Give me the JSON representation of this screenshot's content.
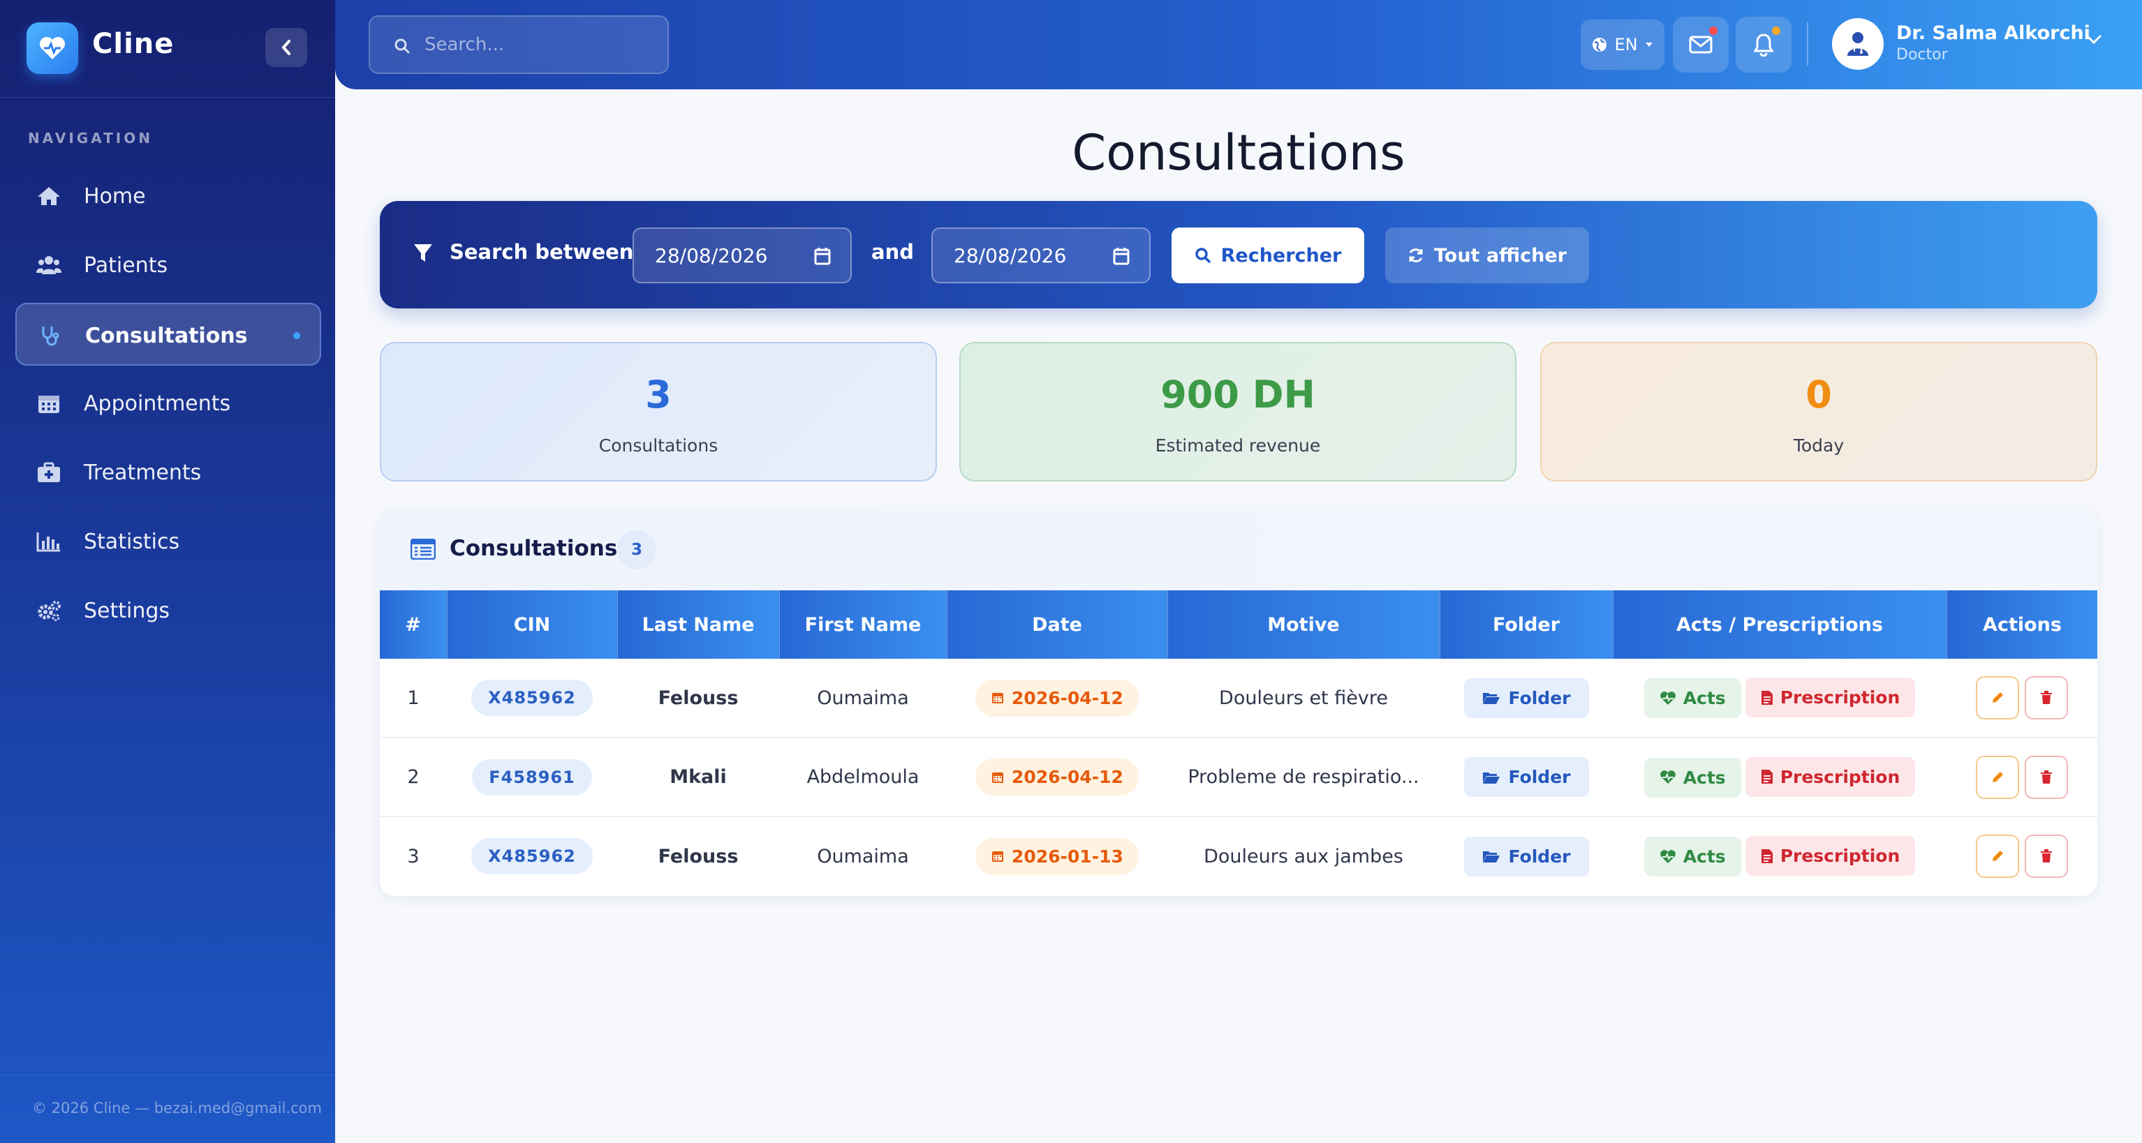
{
  "app": {
    "name": "Cline"
  },
  "sidebar": {
    "nav_title": "NAVIGATION",
    "items": [
      {
        "label": "Home",
        "icon": "home-icon",
        "active": false
      },
      {
        "label": "Patients",
        "icon": "users-icon",
        "active": false
      },
      {
        "label": "Consultations",
        "icon": "stethoscope-icon",
        "active": true
      },
      {
        "label": "Appointments",
        "icon": "calendar-icon",
        "active": false
      },
      {
        "label": "Treatments",
        "icon": "medkit-icon",
        "active": false
      },
      {
        "label": "Statistics",
        "icon": "bar-chart-icon",
        "active": false
      },
      {
        "label": "Settings",
        "icon": "gears-icon",
        "active": false
      }
    ],
    "footer": "© 2026 Cline — bezai.med@gmail.com"
  },
  "topbar": {
    "search_placeholder": "Search...",
    "language": "EN",
    "user": {
      "name": "Dr. Salma Alkorchi",
      "role": "Doctor"
    },
    "message_dot_color": "#ff4d4f",
    "bell_dot_color": "#ffa726"
  },
  "page": {
    "title": "Consultations"
  },
  "filter": {
    "label": "Search between",
    "from_date": "28/08/2026",
    "and_label": "and",
    "to_date": "28/08/2026",
    "search_button": "Rechercher",
    "show_all_button": "Tout afficher"
  },
  "stats": {
    "consultations": {
      "value": "3",
      "label": "Consultations"
    },
    "revenue": {
      "value": "900 DH",
      "label": "Estimated revenue"
    },
    "today": {
      "value": "0",
      "label": "Today"
    }
  },
  "table": {
    "title": "Consultations",
    "count": "3",
    "headers": [
      "#",
      "CIN",
      "Last Name",
      "First Name",
      "Date",
      "Motive",
      "Folder",
      "Acts / Prescriptions",
      "Actions"
    ],
    "rows": [
      {
        "num": "1",
        "cin": "X485962",
        "last_name": "Felouss",
        "first_name": "Oumaima",
        "date": "2026-04-12",
        "motive": "Douleurs et fièvre",
        "folder": "Folder",
        "acts": "Acts",
        "prescription": "Prescription"
      },
      {
        "num": "2",
        "cin": "F458961",
        "last_name": "Mkali",
        "first_name": "Abdelmoula",
        "date": "2026-04-12",
        "motive": "Probleme de respiratio...",
        "folder": "Folder",
        "acts": "Acts",
        "prescription": "Prescription"
      },
      {
        "num": "3",
        "cin": "X485962",
        "last_name": "Felouss",
        "first_name": "Oumaima",
        "date": "2026-01-13",
        "motive": "Douleurs aux jambes",
        "folder": "Folder",
        "acts": "Acts",
        "prescription": "Prescription"
      }
    ]
  },
  "colors": {
    "sidebar_top": "#152070",
    "accent_blue": "#2868d4",
    "revenue_green": "#3d9a47",
    "today_orange": "#f08c12",
    "prescription_red": "#cf2731"
  }
}
